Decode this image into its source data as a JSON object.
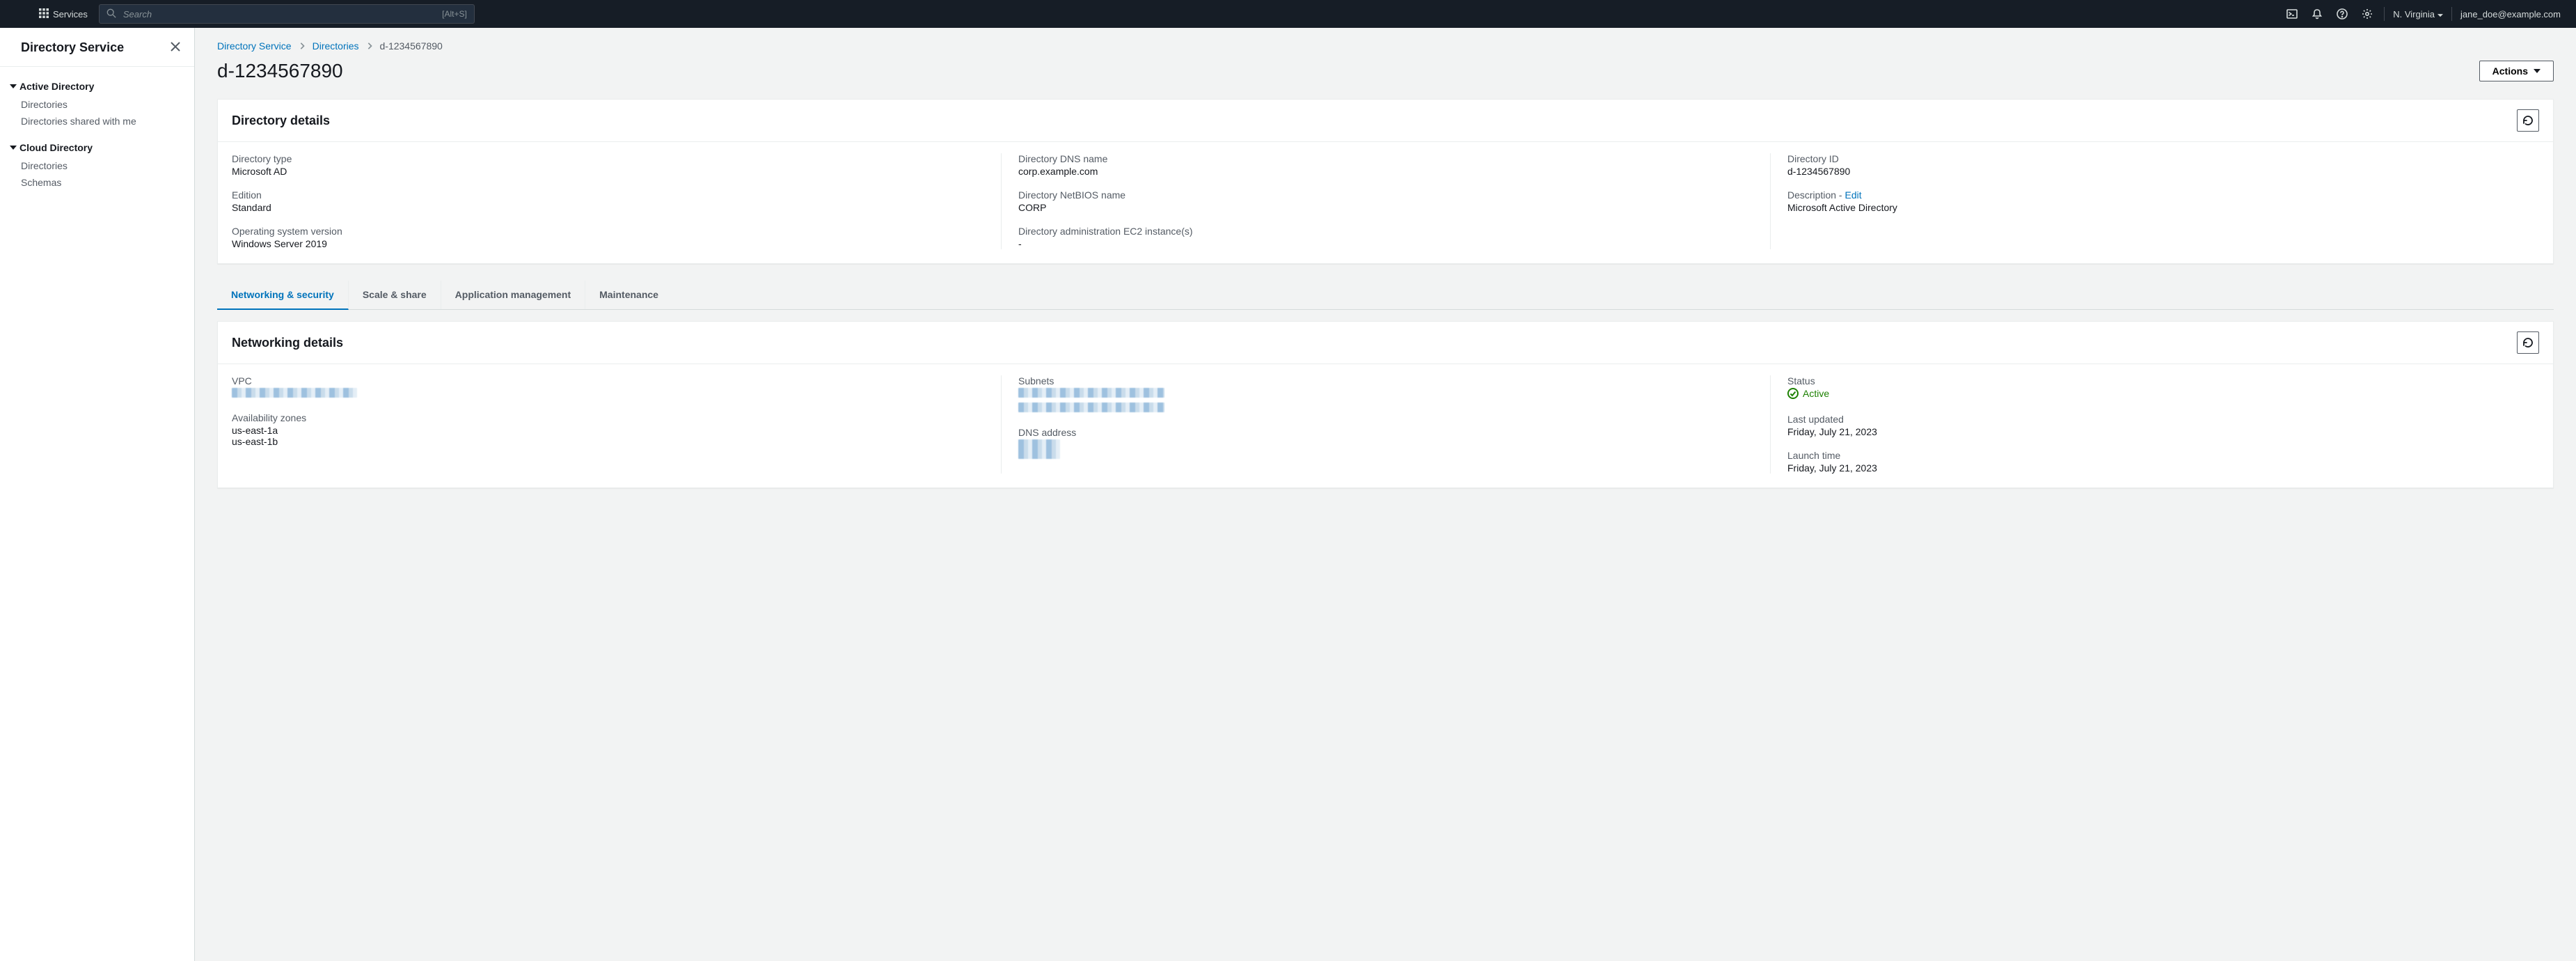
{
  "header": {
    "services_label": "Services",
    "search_placeholder": "Search",
    "search_shortcut": "[Alt+S]",
    "region": "N. Virginia",
    "user": "jane_doe@example.com"
  },
  "sidebar": {
    "title": "Directory Service",
    "groups": [
      {
        "label": "Active Directory",
        "items": [
          "Directories",
          "Directories shared with me"
        ]
      },
      {
        "label": "Cloud Directory",
        "items": [
          "Directories",
          "Schemas"
        ]
      }
    ]
  },
  "breadcrumb": {
    "items": [
      "Directory Service",
      "Directories",
      "d-1234567890"
    ]
  },
  "page_title": "d-1234567890",
  "actions_label": "Actions",
  "details_panel": {
    "title": "Directory details",
    "fields": {
      "directory_type_label": "Directory type",
      "directory_type_value": "Microsoft AD",
      "edition_label": "Edition",
      "edition_value": "Standard",
      "os_version_label": "Operating system version",
      "os_version_value": "Windows Server 2019",
      "dns_name_label": "Directory DNS name",
      "dns_name_value": "corp.example.com",
      "netbios_label": "Directory NetBIOS name",
      "netbios_value": "CORP",
      "admin_ec2_label": "Directory administration EC2 instance(s)",
      "admin_ec2_value": "-",
      "directory_id_label": "Directory ID",
      "directory_id_value": "d-1234567890",
      "description_label": "Description",
      "description_edit": "Edit",
      "description_value": "Microsoft Active Directory"
    }
  },
  "tabs": [
    {
      "label": "Networking & security",
      "active": true
    },
    {
      "label": "Scale & share",
      "active": false
    },
    {
      "label": "Application management",
      "active": false
    },
    {
      "label": "Maintenance",
      "active": false
    }
  ],
  "networking_panel": {
    "title": "Networking details",
    "fields": {
      "vpc_label": "VPC",
      "az_label": "Availability zones",
      "az_value_1": "us-east-1a",
      "az_value_2": "us-east-1b",
      "subnets_label": "Subnets",
      "dns_address_label": "DNS address",
      "status_label": "Status",
      "status_value": "Active",
      "last_updated_label": "Last updated",
      "last_updated_value": "Friday, July 21, 2023",
      "launch_time_label": "Launch time",
      "launch_time_value": "Friday, July 21, 2023"
    }
  }
}
